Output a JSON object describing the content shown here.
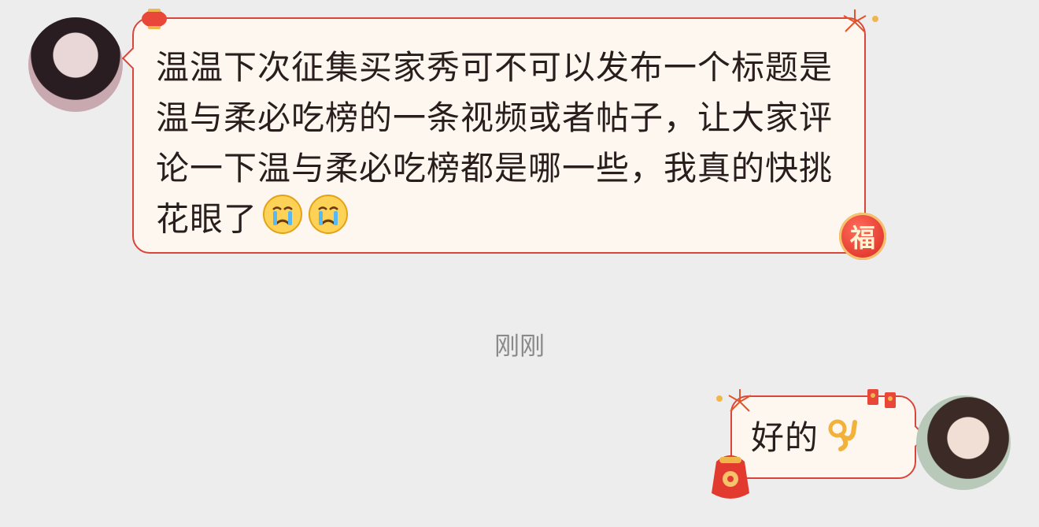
{
  "incoming": {
    "text": "温温下次征集买家秀可不可以发布一个标题是温与柔必吃榜的一条视频或者帖子，让大家评论一下温与柔必吃榜都是哪一些，我真的快挑花眼了",
    "emojis": [
      "crying-face",
      "crying-face"
    ],
    "decorations": {
      "fu": "福"
    }
  },
  "timestamp": "刚刚",
  "outgoing": {
    "text": "好的",
    "emojis": [
      "ok-hand"
    ]
  }
}
